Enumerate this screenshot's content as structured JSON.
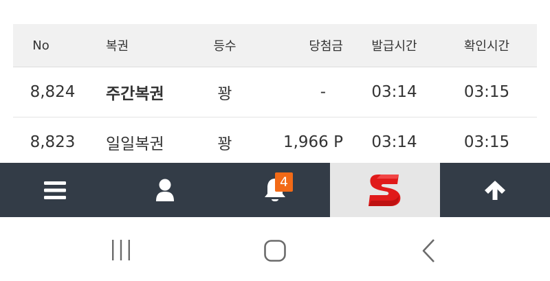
{
  "table": {
    "headers": {
      "no": "No",
      "type": "복권",
      "rank": "등수",
      "prize": "당첨금",
      "issued": "발급시간",
      "checked": "확인시간"
    },
    "rows": [
      {
        "no": "8,824",
        "type": "주간복권",
        "rank": "꽝",
        "prize": "-",
        "issued": "03:14",
        "checked": "03:15"
      },
      {
        "no": "8,823",
        "type": "일일복권",
        "rank": "꽝",
        "prize": "1,966 P",
        "issued": "03:14",
        "checked": "03:15"
      }
    ]
  },
  "navbar": {
    "items": [
      {
        "icon": "menu-icon"
      },
      {
        "icon": "user-icon"
      },
      {
        "icon": "bell-icon",
        "badge": "4"
      },
      {
        "icon": "logo-s"
      },
      {
        "icon": "arrow-up-icon"
      }
    ],
    "colors": {
      "bar": "#333c47",
      "badge": "#f26a17",
      "logo_bg": "#e6e6e6",
      "logo": "#e01a1a"
    }
  },
  "system_nav": {
    "buttons": [
      "recent-apps-icon",
      "home-icon",
      "back-icon"
    ]
  }
}
